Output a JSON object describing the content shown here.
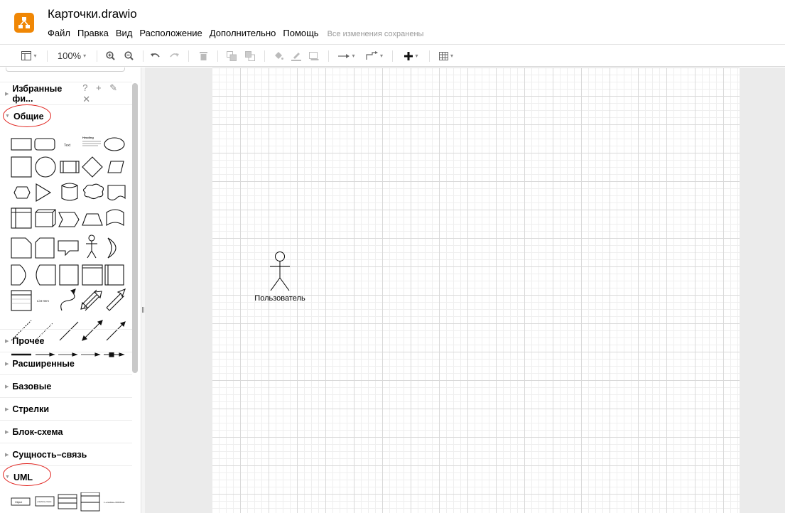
{
  "app": {
    "file_title": "Карточки.drawio",
    "logo_icon": "drawio-logo-icon"
  },
  "menu": {
    "items": [
      "Файл",
      "Правка",
      "Вид",
      "Расположение",
      "Дополнительно",
      "Помощь"
    ],
    "status": "Все изменения сохранены"
  },
  "toolbar": {
    "zoom": "100%",
    "icons": [
      "panel-layout-icon",
      "zoom-in-icon",
      "zoom-out-icon",
      "undo-icon",
      "redo-icon",
      "delete-icon",
      "to-front-icon",
      "to-back-icon",
      "fill-color-icon",
      "line-color-icon",
      "shadow-icon",
      "connection-style-icon",
      "waypoints-icon",
      "insert-plus-icon",
      "table-icon"
    ]
  },
  "sidebar": {
    "favorites": {
      "label": "Избранные фи...",
      "actions": "? + ✎ ✕"
    },
    "sections": [
      {
        "label": "Общие",
        "expanded": true,
        "highlighted": true
      },
      {
        "label": "Прочее",
        "expanded": false
      },
      {
        "label": "Расширенные",
        "expanded": false
      },
      {
        "label": "Базовые",
        "expanded": false
      },
      {
        "label": "Стрелки",
        "expanded": false
      },
      {
        "label": "Блок-схема",
        "expanded": false
      },
      {
        "label": "Сущность–связь",
        "expanded": false
      },
      {
        "label": "UML",
        "expanded": true,
        "highlighted": true
      }
    ],
    "shape_labels": {
      "text": "Text",
      "heading": "Heading",
      "list_item": "List Item"
    },
    "uml_labels": {
      "object": "Object",
      "interface": "«interface» Name",
      "module": "1 «module» MODULE"
    }
  },
  "canvas": {
    "actor_label": "Пользователь"
  },
  "colors": {
    "accent": "#f08705",
    "highlight_oval": "#e0201b",
    "canvas_bg": "#ebebeb",
    "grid_major": "#d9d9d9",
    "grid_minor": "#efefef"
  }
}
